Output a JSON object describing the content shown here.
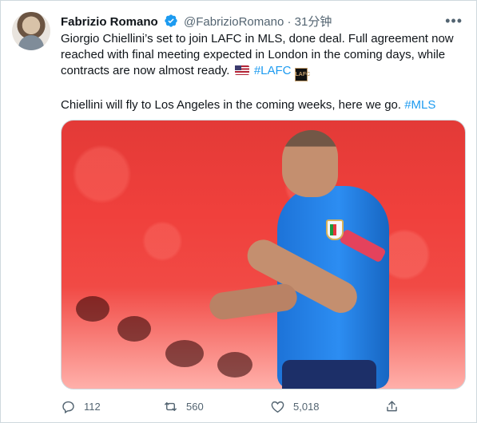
{
  "author": {
    "name": "Fabrizio Romano",
    "handle": "@FabrizioRomano",
    "separator": "·",
    "time": "31分钟"
  },
  "tweet": {
    "line1_text": "Giorgio Chiellini’s set to join LAFC in MLS, done deal. Full agreement now reached with final meeting expected in London in the coming days, while contracts are now almost ready. ",
    "line1_hashtag": "#LAFC",
    "logo_text": "LAFC",
    "line2_text": "Chiellini will fly to Los Angeles in the coming weeks, here we go. ",
    "line2_hashtag": "#MLS"
  },
  "actions": {
    "reply_count": "112",
    "retweet_count": "560",
    "like_count": "5,018"
  },
  "icons": {
    "verified": "verified-badge-icon",
    "more": "more-icon",
    "reply": "reply-icon",
    "retweet": "retweet-icon",
    "like": "like-icon",
    "share": "share-icon",
    "flag": "us-flag-icon",
    "logo": "lafc-logo-icon"
  },
  "colors": {
    "text": "#0f1419",
    "secondary": "#536471",
    "accent": "#1d9bf0"
  }
}
